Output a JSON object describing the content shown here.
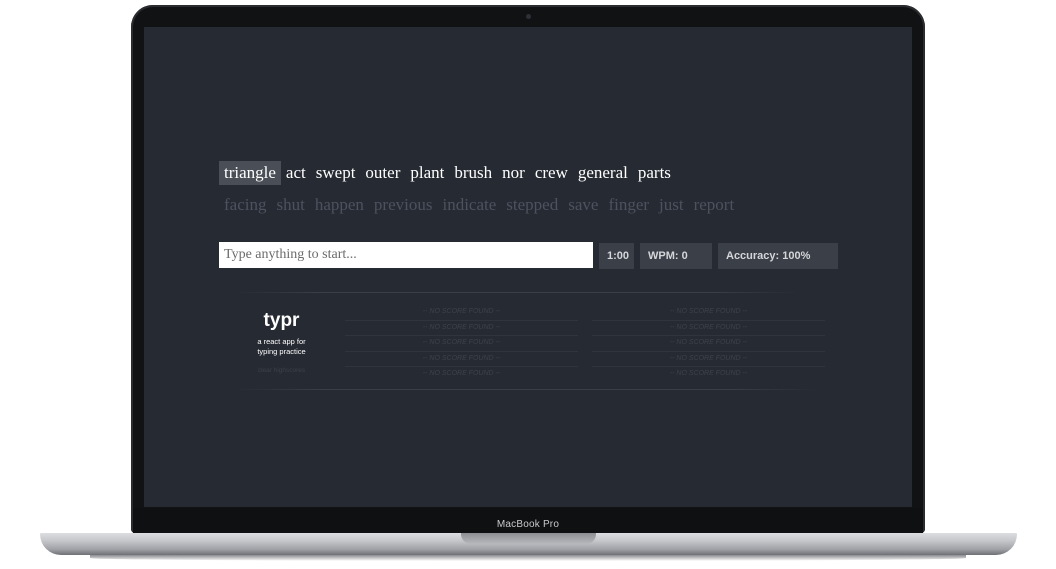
{
  "device": {
    "model_label": "MacBook Pro"
  },
  "app": {
    "words_line1": [
      {
        "text": "triangle",
        "current": true
      },
      {
        "text": "act"
      },
      {
        "text": "swept"
      },
      {
        "text": "outer"
      },
      {
        "text": "plant"
      },
      {
        "text": "brush"
      },
      {
        "text": "nor"
      },
      {
        "text": "crew"
      },
      {
        "text": "general"
      },
      {
        "text": "parts"
      }
    ],
    "words_line2": [
      "facing",
      "shut",
      "happen",
      "previous",
      "indicate",
      "stepped",
      "save",
      "finger",
      "just",
      "report"
    ],
    "input": {
      "placeholder": "Type anything to start...",
      "value": ""
    },
    "stats": {
      "timer": "1:00",
      "wpm": "WPM: 0",
      "accuracy": "Accuracy: 100%"
    },
    "brand": {
      "title": "typr",
      "subtitle_line1": "a react app for",
      "subtitle_line2": "typing practice",
      "clear_highscores": "clear highscores"
    },
    "scores_left": [
      "-- NO SCORE FOUND --",
      "-- NO SCORE FOUND --",
      "-- NO SCORE FOUND --",
      "-- NO SCORE FOUND --",
      "-- NO SCORE FOUND --"
    ],
    "scores_right": [
      "-- NO SCORE FOUND --",
      "-- NO SCORE FOUND --",
      "-- NO SCORE FOUND --",
      "-- NO SCORE FOUND --",
      "-- NO SCORE FOUND --"
    ]
  },
  "colors": {
    "background": "#262a33",
    "current_word_bg": "#4a4e57",
    "stat_bg": "#3b3f48",
    "upcoming_word": "#4c525e"
  }
}
